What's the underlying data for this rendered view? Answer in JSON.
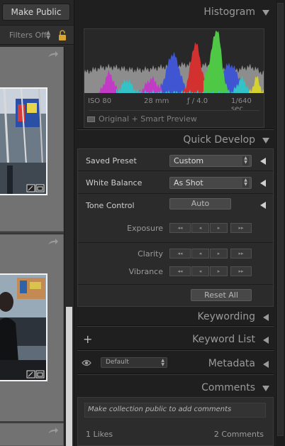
{
  "toolbar": {
    "make_public": "Make Public"
  },
  "filter_bar": {
    "label": "Filters Off"
  },
  "histogram": {
    "title": "Histogram",
    "iso": "ISO 80",
    "focal_length": "28 mm",
    "aperture": "ƒ / 4.0",
    "shutter": "1/640 sec",
    "preview_status": "Original + Smart Preview"
  },
  "quick_develop": {
    "title": "Quick Develop",
    "saved_preset": {
      "label": "Saved Preset",
      "value": "Custom"
    },
    "white_balance": {
      "label": "White Balance",
      "value": "As Shot"
    },
    "tone_control": {
      "label": "Tone Control",
      "auto_button": "Auto"
    },
    "adjustments": [
      "Exposure",
      "Clarity",
      "Vibrance"
    ],
    "step_buttons": [
      "◂◂",
      "◂",
      "▸",
      "▸▸"
    ],
    "reset_button": "Reset All"
  },
  "keywording": {
    "title": "Keywording"
  },
  "keyword_list": {
    "title": "Keyword List",
    "add_symbol": "+"
  },
  "metadata": {
    "title": "Metadata",
    "preset": "Default"
  },
  "comments": {
    "title": "Comments",
    "placeholder": "Make collection public to add comments",
    "likes": "1 Likes",
    "count": "2 Comments"
  },
  "colors": {
    "panel_bg": "#1f1f1f",
    "section_bg": "#2b2b2b",
    "header_text": "#9a9a9a",
    "scroll_thumb": "#d4d4d4"
  }
}
